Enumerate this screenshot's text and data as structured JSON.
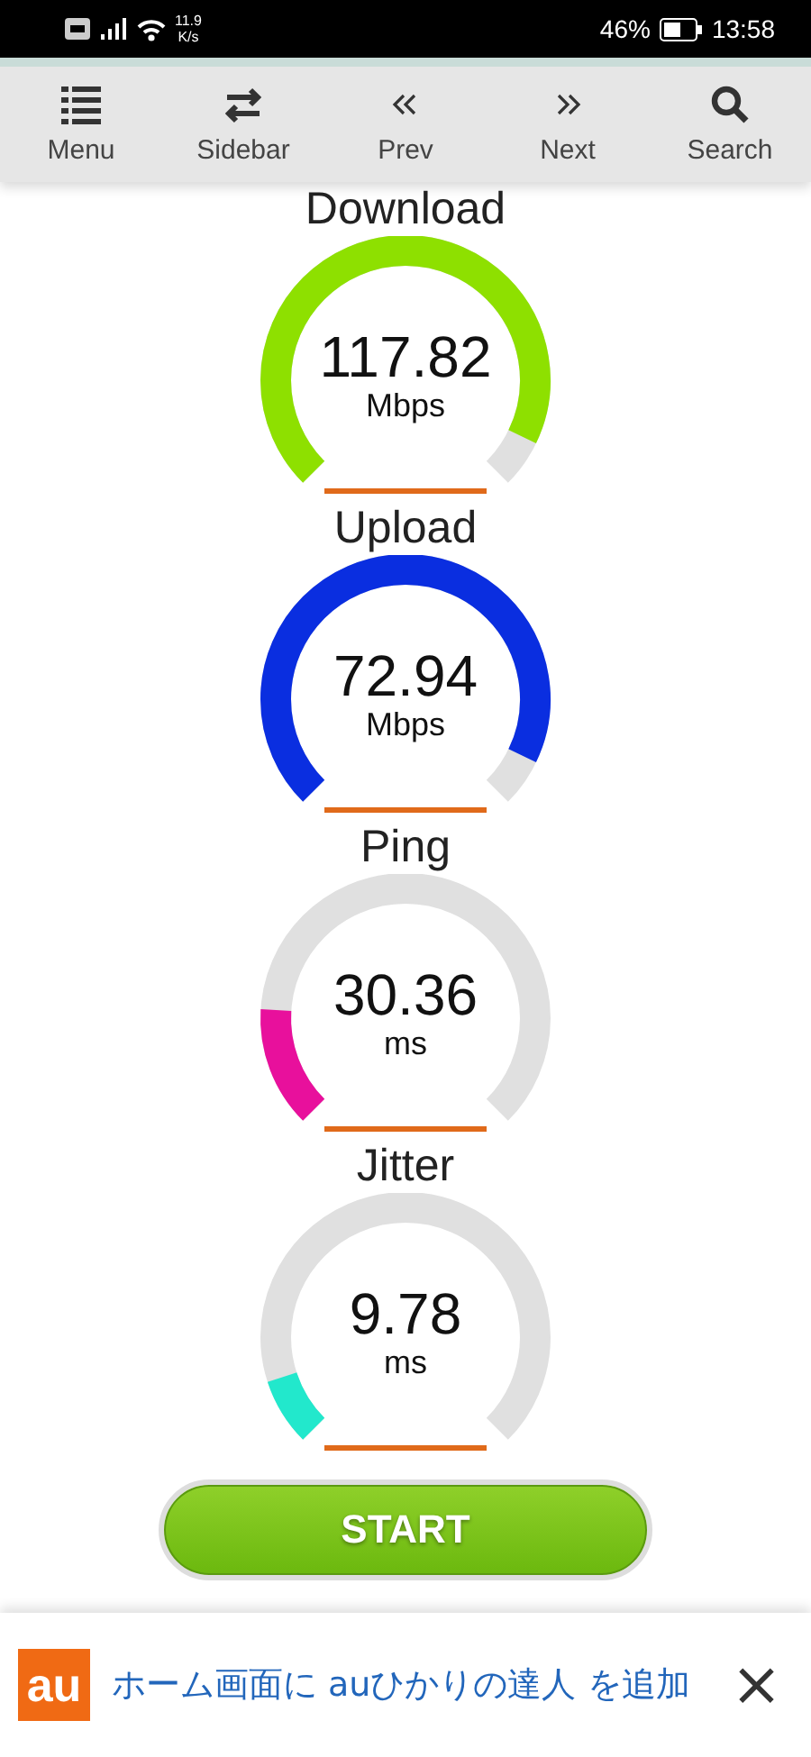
{
  "status_bar": {
    "net_speed": "11.9",
    "net_unit": "K/s",
    "battery": "46%",
    "time": "13:58"
  },
  "toolbar": [
    {
      "label": "Menu",
      "kind": "menu"
    },
    {
      "label": "Sidebar",
      "kind": "swap"
    },
    {
      "label": "Prev",
      "kind": "prev"
    },
    {
      "label": "Next",
      "kind": "next"
    },
    {
      "label": "Search",
      "kind": "search"
    }
  ],
  "gauges": [
    {
      "title": "Download",
      "value": "117.82",
      "unit": "Mbps",
      "color": "#8ee000"
    },
    {
      "title": "Upload",
      "value": "72.94",
      "unit": "Mbps",
      "color": "#0a2ee0"
    },
    {
      "title": "Ping",
      "value": "30.36",
      "unit": "ms",
      "color": "#e8109c"
    },
    {
      "title": "Jitter",
      "value": "9.78",
      "unit": "ms",
      "color": "#22e8cc"
    }
  ],
  "start_button": "START",
  "banner": {
    "logo": "au",
    "text": "ホーム画面に auひかりの達人 を追加",
    "close": "×"
  }
}
